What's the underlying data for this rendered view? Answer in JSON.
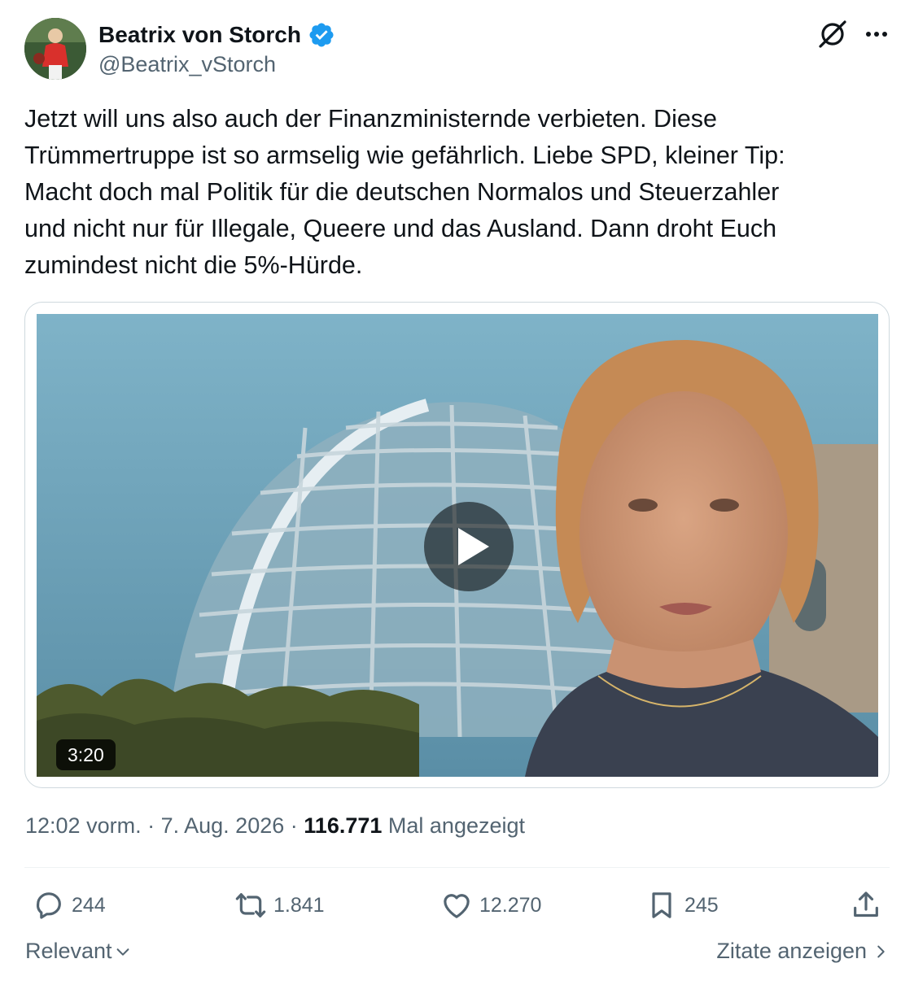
{
  "author": {
    "name": "Beatrix von Storch",
    "handle": "@Beatrix_vStorch"
  },
  "tweet": {
    "text": "Jetzt will uns also auch der Finanzministernde verbieten. Diese\nTrümmertruppe ist so armselig wie gefährlich. Liebe SPD, kleiner Tip:\nMacht doch mal Politik für die deutschen Normalos und Steuerzahler\nund nicht nur für Illegale, Queere und das Ausland. Dann droht Euch\nzumindest nicht die 5%-Hürde."
  },
  "video": {
    "duration": "3:20"
  },
  "meta": {
    "time": "12:02 vorm.",
    "date": "7. Aug. 2026",
    "views_count": "116.771",
    "views_label": "Mal angezeigt",
    "separator": "·"
  },
  "actions": {
    "replies": "244",
    "reposts": "1.841",
    "likes": "12.270",
    "bookmarks": "245"
  },
  "footer": {
    "sort_label": "Relevant",
    "quotes_label": "Zitate anzeigen"
  },
  "colors": {
    "text_primary": "#0f1419",
    "text_secondary": "#536471",
    "verified_blue": "#1d9bf0",
    "border": "#cfd9de"
  },
  "icons": [
    "grok-icon",
    "more-icon",
    "verified-badge-icon",
    "play-icon",
    "reply-icon",
    "repost-icon",
    "like-icon",
    "bookmark-icon",
    "share-icon",
    "chevron-down-icon",
    "chevron-right-icon"
  ]
}
